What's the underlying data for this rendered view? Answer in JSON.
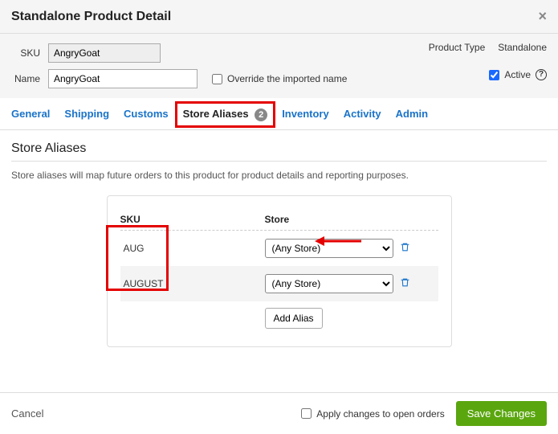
{
  "dialog": {
    "title": "Standalone Product Detail"
  },
  "form": {
    "sku_label": "SKU",
    "sku_value": "AngryGoat",
    "name_label": "Name",
    "name_value": "AngryGoat",
    "override_label": "Override the imported name",
    "product_type_label": "Product Type",
    "product_type_value": "Standalone",
    "active_label": "Active"
  },
  "tabs": {
    "general": "General",
    "shipping": "Shipping",
    "customs": "Customs",
    "store_aliases": "Store Aliases",
    "store_aliases_count": "2",
    "inventory": "Inventory",
    "activity": "Activity",
    "admin": "Admin"
  },
  "section": {
    "title": "Store Aliases",
    "description": "Store aliases will map future orders to this product for product details and reporting purposes.",
    "col_sku": "SKU",
    "col_store": "Store"
  },
  "aliases": [
    {
      "sku": "AUG",
      "store": "(Any Store)"
    },
    {
      "sku": "AUGUST",
      "store": "(Any Store)"
    }
  ],
  "buttons": {
    "add_alias": "Add Alias",
    "cancel": "Cancel",
    "apply_open": "Apply changes to open orders",
    "save": "Save Changes"
  }
}
